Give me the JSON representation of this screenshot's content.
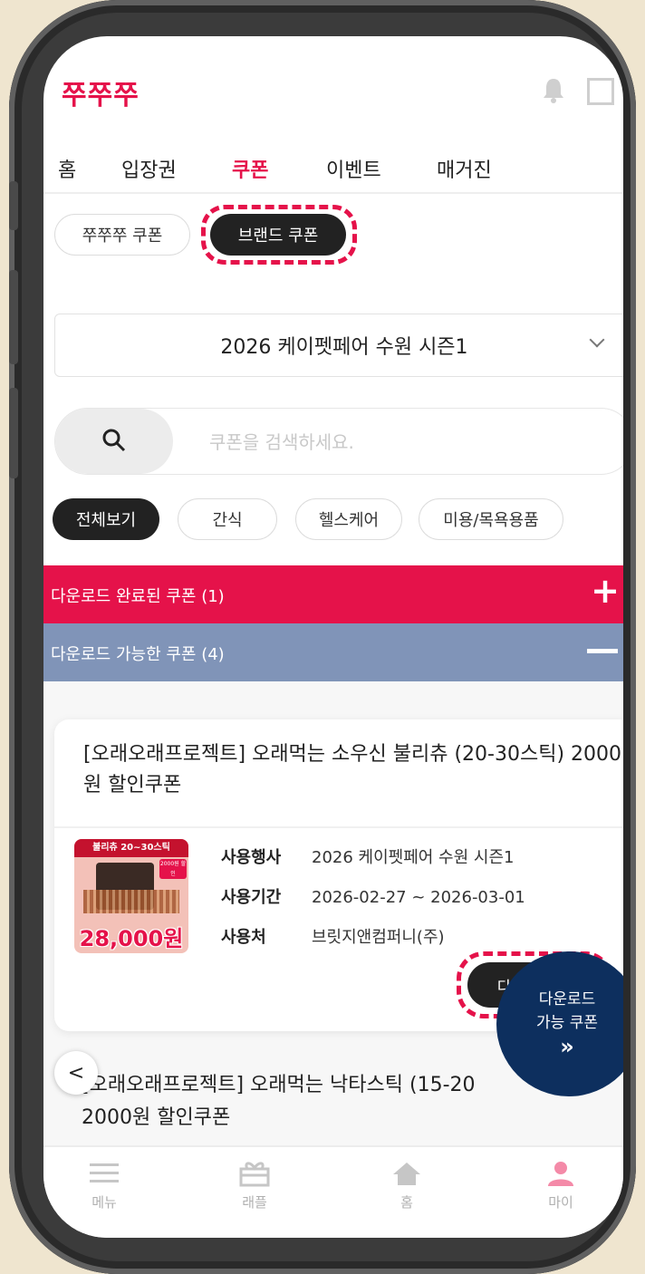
{
  "app": {
    "logo": "쭈쭈쭈"
  },
  "nav": {
    "tabs": [
      "홈",
      "입장권",
      "쿠폰",
      "이벤트",
      "매거진"
    ],
    "active_index": 2
  },
  "coupon_type": {
    "options": [
      "쭈쭈쭈 쿠폰",
      "브랜드 쿠폰"
    ],
    "selected": "브랜드 쿠폰"
  },
  "event_select": {
    "value": "2026 케이펫페어 수원 시즌1"
  },
  "search": {
    "placeholder": "쿠폰을 검색하세요."
  },
  "categories": [
    "전체보기",
    "간식",
    "헬스케어",
    "미용/목욕용품"
  ],
  "sections": {
    "downloaded": {
      "label": "다운로드 완료된 쿠폰 (1)",
      "symbol": "+",
      "color": "#e5124a"
    },
    "available": {
      "label": "다운로드 가능한 쿠폰 (4)",
      "symbol": "—",
      "color": "#8094b8"
    }
  },
  "coupons": [
    {
      "title": "[오래오래프로젝트] 오래먹는 소우신 불리츄 (20-30스틱) 2000원 할인쿠폰",
      "thumb_top": "불리츄 20~30스틱",
      "thumb_badge": "2000원 할인",
      "thumb_price": "28,000원",
      "rows": [
        {
          "label": "사용행사",
          "value": "2026 케이펫페어 수원 시즌1"
        },
        {
          "label": "사용기간",
          "value": "2026-02-27 ~ 2026-03-01"
        },
        {
          "label": "사용처",
          "value": "브릿지앤컴퍼니(주)"
        }
      ],
      "button": "다운로드 >"
    },
    {
      "title_line1": "[오래오래프로젝트] 오래먹는 낙타스틱 (15-20",
      "title_line2": "2000원 할인쿠폰"
    }
  ],
  "fab": {
    "line1": "다운로드",
    "line2": "가능 쿠폰",
    "arrow": "»"
  },
  "back": {
    "glyph": "<"
  },
  "tabbar": [
    "메뉴",
    "래플",
    "홈",
    "마이"
  ],
  "colors": {
    "brand": "#e5124a",
    "navy": "#0d2f5e",
    "slate": "#8094b8"
  }
}
